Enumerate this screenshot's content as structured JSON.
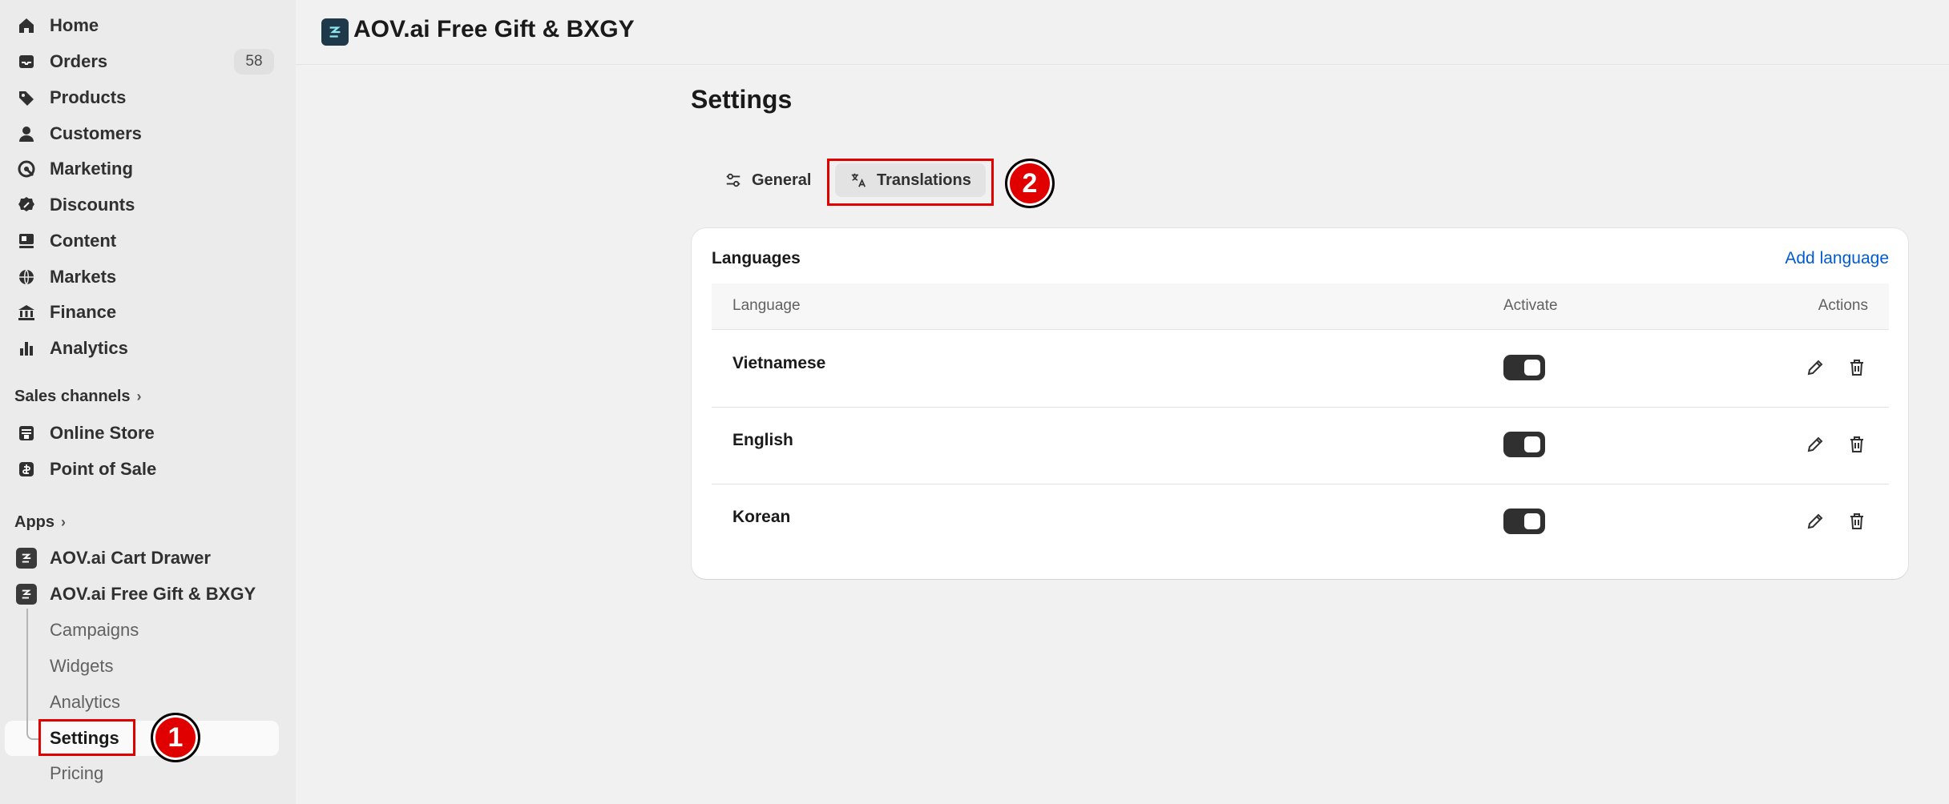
{
  "sidebar": {
    "nav": [
      {
        "label": "Home",
        "icon": "home-icon"
      },
      {
        "label": "Orders",
        "icon": "inbox-icon",
        "badge": "58"
      },
      {
        "label": "Products",
        "icon": "tag-icon"
      },
      {
        "label": "Customers",
        "icon": "person-icon"
      },
      {
        "label": "Marketing",
        "icon": "target-icon"
      },
      {
        "label": "Discounts",
        "icon": "discount-icon"
      },
      {
        "label": "Content",
        "icon": "content-icon"
      },
      {
        "label": "Markets",
        "icon": "globe-icon"
      },
      {
        "label": "Finance",
        "icon": "bank-icon"
      },
      {
        "label": "Analytics",
        "icon": "bar-chart-icon"
      }
    ],
    "sales_channels_label": "Sales channels",
    "channels": [
      {
        "label": "Online Store",
        "icon": "store-icon"
      },
      {
        "label": "Point of Sale",
        "icon": "pos-icon"
      }
    ],
    "apps_label": "Apps",
    "apps": [
      {
        "label": "AOV.ai Cart Drawer"
      },
      {
        "label": "AOV.ai Free Gift & BXGY"
      }
    ],
    "app_subitems": [
      {
        "label": "Campaigns"
      },
      {
        "label": "Widgets"
      },
      {
        "label": "Analytics"
      },
      {
        "label": "Settings",
        "active": true
      },
      {
        "label": "Pricing"
      }
    ]
  },
  "header": {
    "title": "AOV.ai Free Gift & BXGY"
  },
  "main": {
    "page_title": "Settings",
    "tabs": [
      {
        "label": "General",
        "icon": "sliders-icon"
      },
      {
        "label": "Translations",
        "icon": "translate-icon",
        "active": true
      }
    ],
    "card": {
      "title": "Languages",
      "add_label": "Add language",
      "columns": [
        "Language",
        "Activate",
        "Actions"
      ],
      "rows": [
        {
          "language": "Vietnamese",
          "active": true
        },
        {
          "language": "English",
          "active": true
        },
        {
          "language": "Korean",
          "active": true
        }
      ]
    }
  },
  "annotations": [
    "1",
    "2"
  ],
  "colors": {
    "accent_link": "#005bd3",
    "annotation_red": "#e00000",
    "toggle_on": "#303030"
  }
}
